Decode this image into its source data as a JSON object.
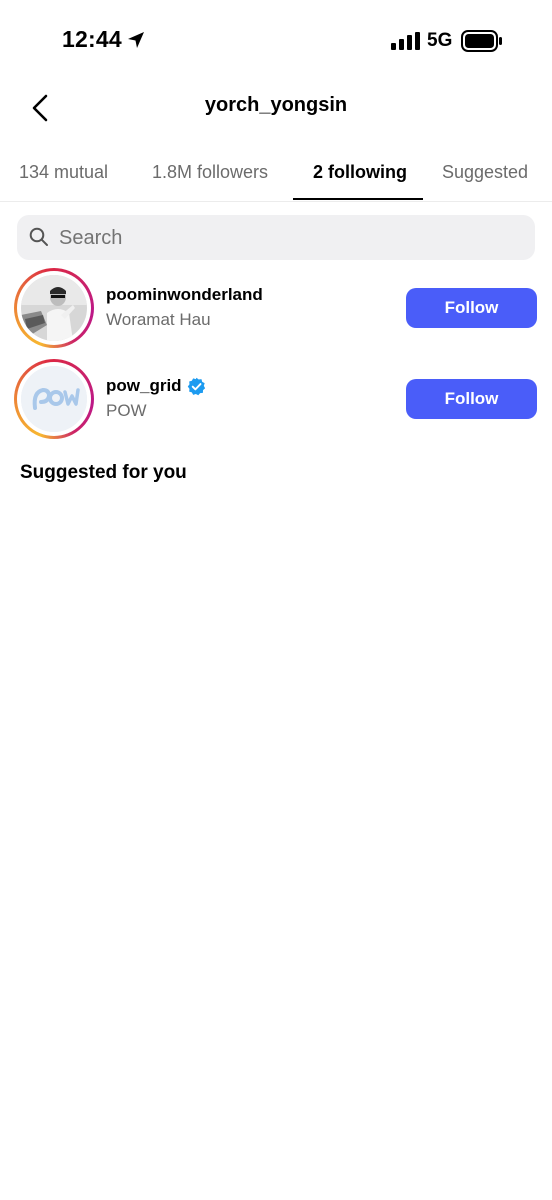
{
  "status_bar": {
    "time": "12:44",
    "network": "5G",
    "icons": [
      "location-arrow-icon",
      "signal-icon",
      "battery-icon"
    ]
  },
  "header": {
    "title": "yorch_yongsin",
    "back_icon": "chevron-left-icon"
  },
  "tabs": [
    {
      "label": "134 mutual",
      "active": false
    },
    {
      "label": "1.8M followers",
      "active": false
    },
    {
      "label": "2 following",
      "active": true
    },
    {
      "label": "Suggested",
      "active": false
    }
  ],
  "search": {
    "placeholder": "Search",
    "value": ""
  },
  "following": [
    {
      "username": "poominwonderland",
      "full_name": "Woramat Hau",
      "verified": false,
      "button_label": "Follow"
    },
    {
      "username": "pow_grid",
      "full_name": "POW",
      "verified": true,
      "button_label": "Follow"
    }
  ],
  "suggested": {
    "title": "Suggested for you"
  },
  "colors": {
    "follow_button": "#4a5df9",
    "verified_badge": "#1d9bf0",
    "muted_text": "#6b6b6b"
  }
}
